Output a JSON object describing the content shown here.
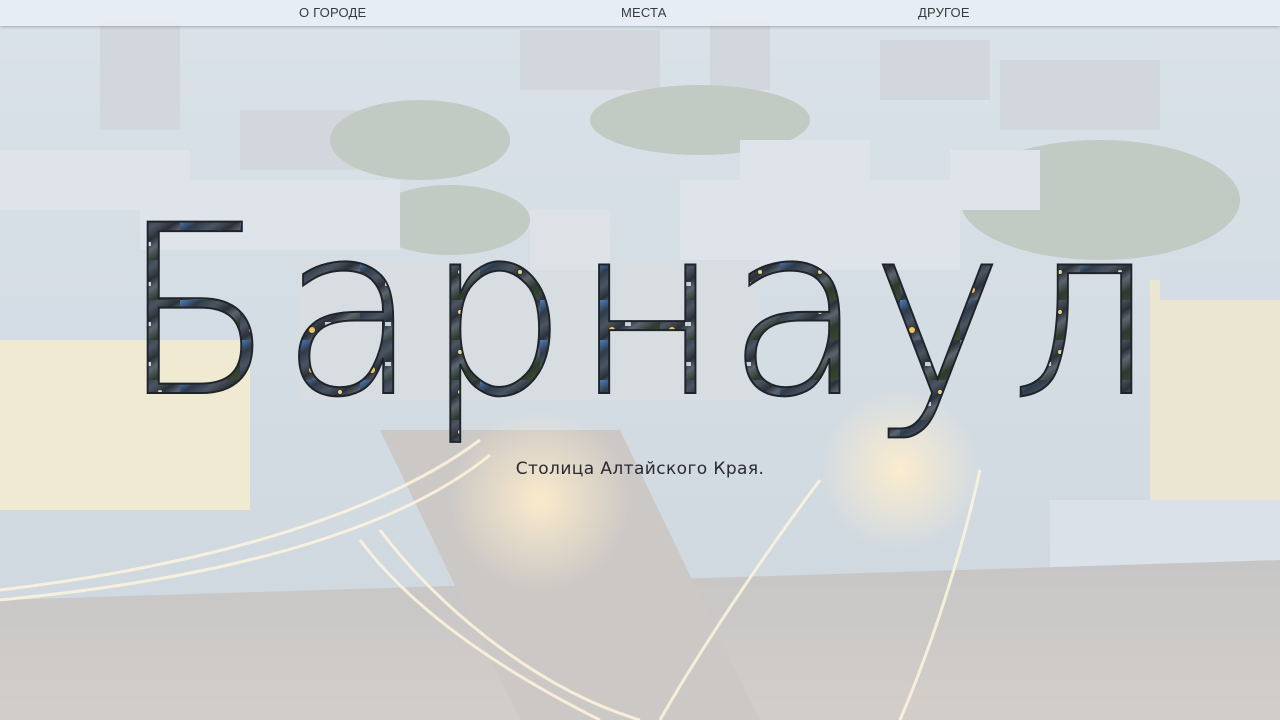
{
  "nav": {
    "items": [
      {
        "label": "О ГОРОДЕ"
      },
      {
        "label": "МЕСТА"
      },
      {
        "label": "ДРУГОЕ"
      }
    ]
  },
  "hero": {
    "title": "Барнаул",
    "subtitle": "Столица Алтайского Края."
  },
  "colors": {
    "nav_bg": "#e8eef4",
    "text": "#3a3a3a",
    "subtitle": "#2a2a32",
    "title_fill_dark": "#2b3038",
    "title_fill_blue": "#4a7fc0",
    "title_fill_light": "#f2c45a"
  },
  "icons": []
}
